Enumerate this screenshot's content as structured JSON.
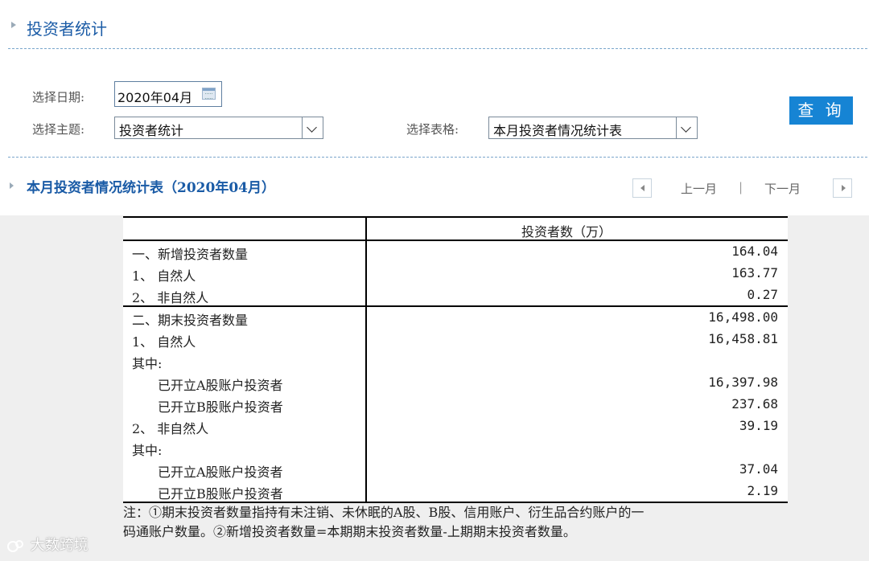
{
  "page": {
    "title": "投资者统计"
  },
  "filters": {
    "date_label": "选择日期:",
    "date_value": "2020年04月",
    "topic_label": "选择主题:",
    "topic_value": "投资者统计",
    "table_label": "选择表格:",
    "table_value": "本月投资者情况统计表",
    "query_button": "查 询"
  },
  "section": {
    "title": "本月投资者情况统计表（2020年04月）",
    "prev_month": "上一月",
    "separator": "|",
    "next_month": "下一月"
  },
  "table": {
    "column_header": "投资者数（万）",
    "rows": [
      {
        "label": "一、新增投资者数量",
        "value": "164.04"
      },
      {
        "label": "1、 自然人",
        "value": "163.77"
      },
      {
        "label": "2、 非自然人",
        "value": "0.27"
      },
      {
        "label": "二、期末投资者数量",
        "value": "16,498.00"
      },
      {
        "label": "1、 自然人",
        "value": "16,458.81"
      },
      {
        "label": "其中:",
        "value": ""
      },
      {
        "label": "已开立A股账户投资者",
        "value": "16,397.98"
      },
      {
        "label": "已开立B股账户投资者",
        "value": "237.68"
      },
      {
        "label": "2、 非自然人",
        "value": "39.19"
      },
      {
        "label": "其中:",
        "value": ""
      },
      {
        "label": "已开立A股账户投资者",
        "value": "37.04"
      },
      {
        "label": "已开立B股账户投资者",
        "value": "2.19"
      }
    ],
    "note_line1": "注：①期末投资者数量指持有未注销、未休眠的A股、B股、信用账户、衍生品合约账户的一",
    "note_line2": "码通账户数量。②新增投资者数量=本期期末投资者数量-上期期末投资者数量。"
  },
  "watermark": {
    "text": "大数跨境"
  },
  "colors": {
    "accent": "#1684d4",
    "title": "#1a5ba6",
    "panel": "#efefef"
  }
}
